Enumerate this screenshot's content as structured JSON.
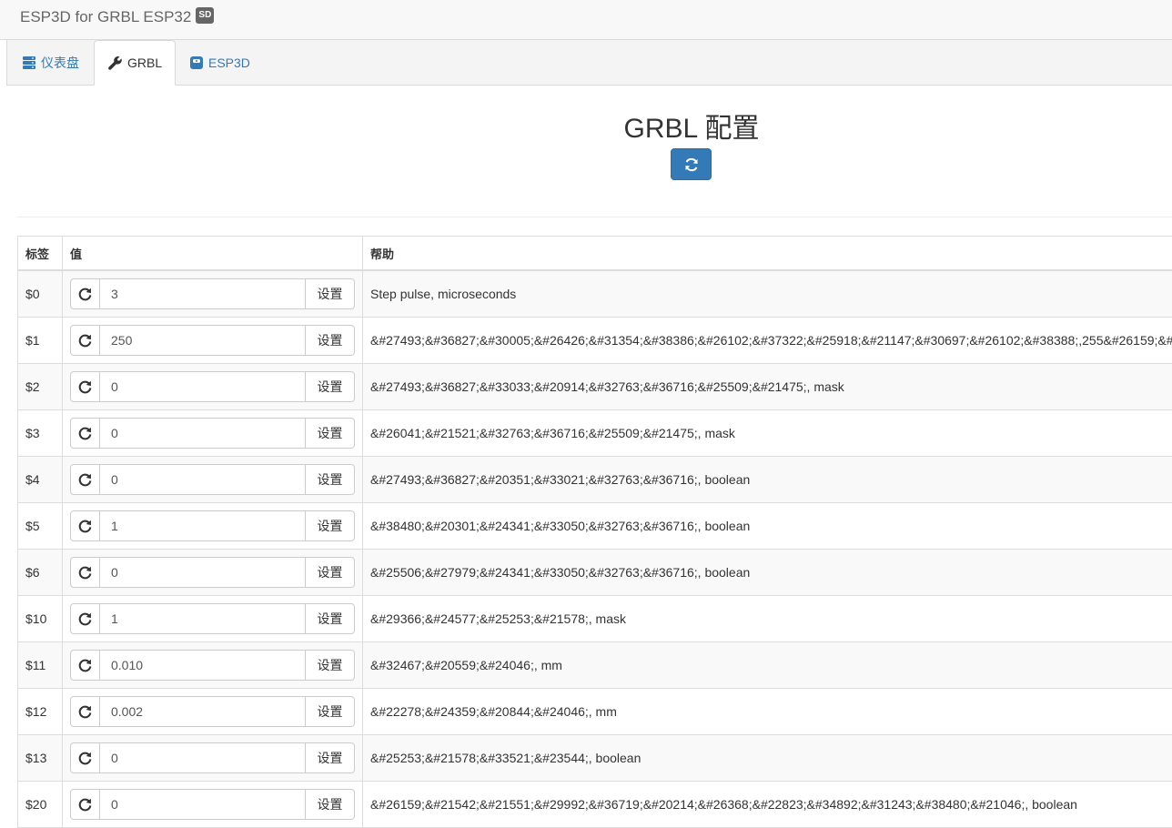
{
  "app": {
    "title": "ESP3D for GRBL ESP32",
    "sd_badge": "SD"
  },
  "tabs": [
    {
      "label": "仪表盘",
      "icon": "server-icon"
    },
    {
      "label": "GRBL",
      "icon": "wrench-icon"
    },
    {
      "label": "ESP3D",
      "icon": "esp3d-icon"
    }
  ],
  "page": {
    "title": "GRBL 配置"
  },
  "table": {
    "headers": [
      "标签",
      "值",
      "帮助"
    ],
    "set_label": "设置",
    "rows": [
      {
        "label": "$0",
        "value": "3",
        "help": "Step pulse, microseconds"
      },
      {
        "label": "$1",
        "value": "250",
        "help": "&#27493;&#36827;&#30005;&#26426;&#31354;&#38386;&#26102;&#37322;&#25918;&#21147;&#30697;&#26102;&#38388;,255&#26159;&#"
      },
      {
        "label": "$2",
        "value": "0",
        "help": "&#27493;&#36827;&#33033;&#20914;&#32763;&#36716;&#25509;&#21475;, mask"
      },
      {
        "label": "$3",
        "value": "0",
        "help": "&#26041;&#21521;&#32763;&#36716;&#25509;&#21475;, mask"
      },
      {
        "label": "$4",
        "value": "0",
        "help": "&#27493;&#36827;&#20351;&#33021;&#32763;&#36716;, boolean"
      },
      {
        "label": "$5",
        "value": "1",
        "help": "&#38480;&#20301;&#24341;&#33050;&#32763;&#36716;, boolean"
      },
      {
        "label": "$6",
        "value": "0",
        "help": "&#25506;&#27979;&#24341;&#33050;&#32763;&#36716;, boolean"
      },
      {
        "label": "$10",
        "value": "1",
        "help": "&#29366;&#24577;&#25253;&#21578;, mask"
      },
      {
        "label": "$11",
        "value": "0.010",
        "help": "&#32467;&#20559;&#24046;, mm"
      },
      {
        "label": "$12",
        "value": "0.002",
        "help": "&#22278;&#24359;&#20844;&#24046;, mm"
      },
      {
        "label": "$13",
        "value": "0",
        "help": "&#25253;&#21578;&#33521;&#23544;, boolean"
      },
      {
        "label": "$20",
        "value": "0",
        "help": "&#26159;&#21542;&#21551;&#29992;&#36719;&#20214;&#26368;&#22823;&#34892;&#31243;&#38480;&#21046;, boolean"
      }
    ]
  },
  "colors": {
    "primary": "#337ab7",
    "link": "#337ab7",
    "border": "#dddddd",
    "stripe": "#f9f9f9"
  }
}
